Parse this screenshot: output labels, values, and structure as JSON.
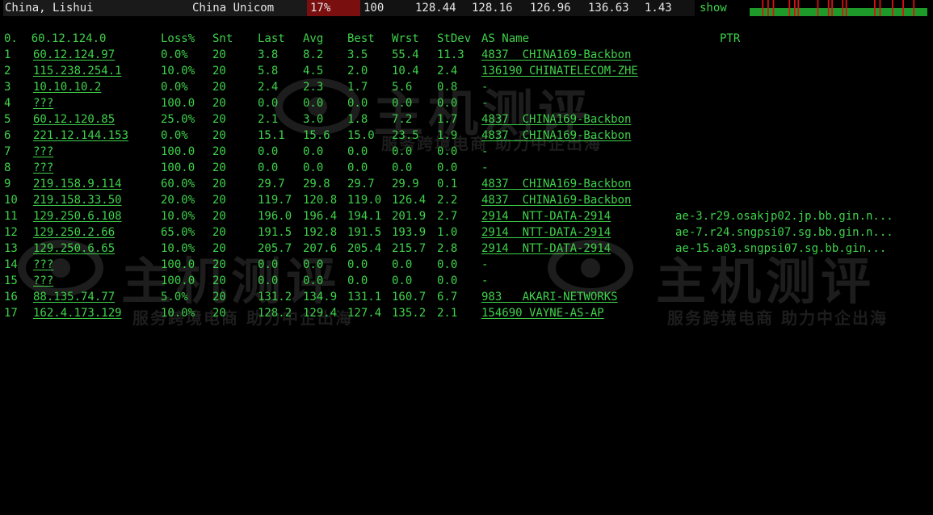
{
  "header": {
    "location": "China, Lishui",
    "isp": "China Unicom",
    "loss": "17%",
    "snt": "100",
    "last": "128.44",
    "avg": "128.16",
    "best": "126.96",
    "wrst": "136.63",
    "stdev": "1.43",
    "show_label": "show"
  },
  "columns": {
    "index_host": "0.  60.12.124.0",
    "loss": "Loss%",
    "snt": "Snt",
    "last": "Last",
    "avg": "Avg",
    "best": "Best",
    "wrst": "Wrst",
    "stdev": "StDev",
    "as_name": "AS Name",
    "ptr": "PTR"
  },
  "rows": [
    {
      "idx": "1",
      "host": "60.12.124.97",
      "loss": "0.0%",
      "snt": "20",
      "last": "3.8",
      "avg": "8.2",
      "best": "3.5",
      "wrst": "55.4",
      "stdev": "11.3",
      "as": "4837  CHINA169-Backbon",
      "ptr": ""
    },
    {
      "idx": "2",
      "host": "115.238.254.1",
      "loss": "10.0%",
      "snt": "20",
      "last": "5.8",
      "avg": "4.5",
      "best": "2.0",
      "wrst": "10.4",
      "stdev": "2.4",
      "as": "136190 CHINATELECOM-ZHE",
      "ptr": ""
    },
    {
      "idx": "3",
      "host": "10.10.10.2",
      "loss": "0.0%",
      "snt": "20",
      "last": "2.4",
      "avg": "2.3",
      "best": "1.7",
      "wrst": "5.6",
      "stdev": "0.8",
      "as": "-",
      "ptr": ""
    },
    {
      "idx": "4",
      "host": "???",
      "loss": "100.0",
      "snt": "20",
      "last": "0.0",
      "avg": "0.0",
      "best": "0.0",
      "wrst": "0.0",
      "stdev": "0.0",
      "as": "-",
      "ptr": ""
    },
    {
      "idx": "5",
      "host": "60.12.120.85",
      "loss": "25.0%",
      "snt": "20",
      "last": "2.1",
      "avg": "3.0",
      "best": "1.8",
      "wrst": "7.2",
      "stdev": "1.7",
      "as": "4837  CHINA169-Backbon",
      "ptr": ""
    },
    {
      "idx": "6",
      "host": "221.12.144.153",
      "loss": "0.0%",
      "snt": "20",
      "last": "15.1",
      "avg": "15.6",
      "best": "15.0",
      "wrst": "23.5",
      "stdev": "1.9",
      "as": "4837  CHINA169-Backbon",
      "ptr": ""
    },
    {
      "idx": "7",
      "host": "???",
      "loss": "100.0",
      "snt": "20",
      "last": "0.0",
      "avg": "0.0",
      "best": "0.0",
      "wrst": "0.0",
      "stdev": "0.0",
      "as": "-",
      "ptr": ""
    },
    {
      "idx": "8",
      "host": "???",
      "loss": "100.0",
      "snt": "20",
      "last": "0.0",
      "avg": "0.0",
      "best": "0.0",
      "wrst": "0.0",
      "stdev": "0.0",
      "as": "-",
      "ptr": ""
    },
    {
      "idx": "9",
      "host": "219.158.9.114",
      "loss": "60.0%",
      "snt": "20",
      "last": "29.7",
      "avg": "29.8",
      "best": "29.7",
      "wrst": "29.9",
      "stdev": "0.1",
      "as": "4837  CHINA169-Backbon",
      "ptr": ""
    },
    {
      "idx": "10",
      "host": "219.158.33.50",
      "loss": "20.0%",
      "snt": "20",
      "last": "119.7",
      "avg": "120.8",
      "best": "119.0",
      "wrst": "126.4",
      "stdev": "2.2",
      "as": "4837  CHINA169-Backbon",
      "ptr": ""
    },
    {
      "idx": "11",
      "host": "129.250.6.108",
      "loss": "10.0%",
      "snt": "20",
      "last": "196.0",
      "avg": "196.4",
      "best": "194.1",
      "wrst": "201.9",
      "stdev": "2.7",
      "as": "2914  NTT-DATA-2914",
      "ptr": "ae-3.r29.osakjp02.jp.bb.gin.n..."
    },
    {
      "idx": "12",
      "host": "129.250.2.66",
      "loss": "65.0%",
      "snt": "20",
      "last": "191.5",
      "avg": "192.8",
      "best": "191.5",
      "wrst": "193.9",
      "stdev": "1.0",
      "as": "2914  NTT-DATA-2914",
      "ptr": "ae-7.r24.sngpsi07.sg.bb.gin.n..."
    },
    {
      "idx": "13",
      "host": "129.250.6.65",
      "loss": "10.0%",
      "snt": "20",
      "last": "205.7",
      "avg": "207.6",
      "best": "205.4",
      "wrst": "215.7",
      "stdev": "2.8",
      "as": "2914  NTT-DATA-2914",
      "ptr": "ae-15.a03.sngpsi07.sg.bb.gin..."
    },
    {
      "idx": "14",
      "host": "???",
      "loss": "100.0",
      "snt": "20",
      "last": "0.0",
      "avg": "0.0",
      "best": "0.0",
      "wrst": "0.0",
      "stdev": "0.0",
      "as": "-",
      "ptr": ""
    },
    {
      "idx": "15",
      "host": "???",
      "loss": "100.0",
      "snt": "20",
      "last": "0.0",
      "avg": "0.0",
      "best": "0.0",
      "wrst": "0.0",
      "stdev": "0.0",
      "as": "-",
      "ptr": ""
    },
    {
      "idx": "16",
      "host": "88.135.74.77",
      "loss": "5.0%",
      "snt": "20",
      "last": "131.2",
      "avg": "134.9",
      "best": "131.1",
      "wrst": "160.7",
      "stdev": "6.7",
      "as": "983   AKARI-NETWORKS",
      "ptr": ""
    },
    {
      "idx": "17",
      "host": "162.4.173.129",
      "loss": "10.0%",
      "snt": "20",
      "last": "128.2",
      "avg": "129.4",
      "best": "127.4",
      "wrst": "135.2",
      "stdev": "2.1",
      "as": "154690 VAYNE-AS-AP",
      "ptr": ""
    }
  ],
  "sparkline": {
    "bars": [
      0,
      0,
      0,
      0,
      0,
      0,
      0,
      1,
      0,
      0,
      1,
      0,
      0,
      1,
      0,
      0,
      0,
      0,
      0,
      0,
      0,
      0,
      1,
      0,
      0,
      1,
      0,
      1,
      0,
      0,
      0,
      0,
      0,
      0,
      0,
      0,
      0,
      0,
      1,
      0,
      0,
      0,
      0,
      0,
      1,
      0,
      1,
      0,
      0,
      0,
      0,
      0,
      1,
      0,
      1,
      0,
      0,
      0,
      0,
      0,
      0,
      0,
      0,
      0,
      0,
      0,
      0,
      0,
      0,
      0,
      1,
      0,
      0,
      1,
      0,
      0,
      0,
      0,
      0,
      0,
      1,
      0,
      0,
      0,
      0,
      0,
      1,
      0,
      0,
      0,
      0,
      0,
      1,
      0,
      0,
      0,
      0,
      0,
      0,
      0
    ],
    "ok_color": "#1d9a2a",
    "loss_color": "#e01010"
  },
  "watermark": {
    "brand": "主机测评",
    "slogan": "服务跨境电商 助力中企出海"
  }
}
